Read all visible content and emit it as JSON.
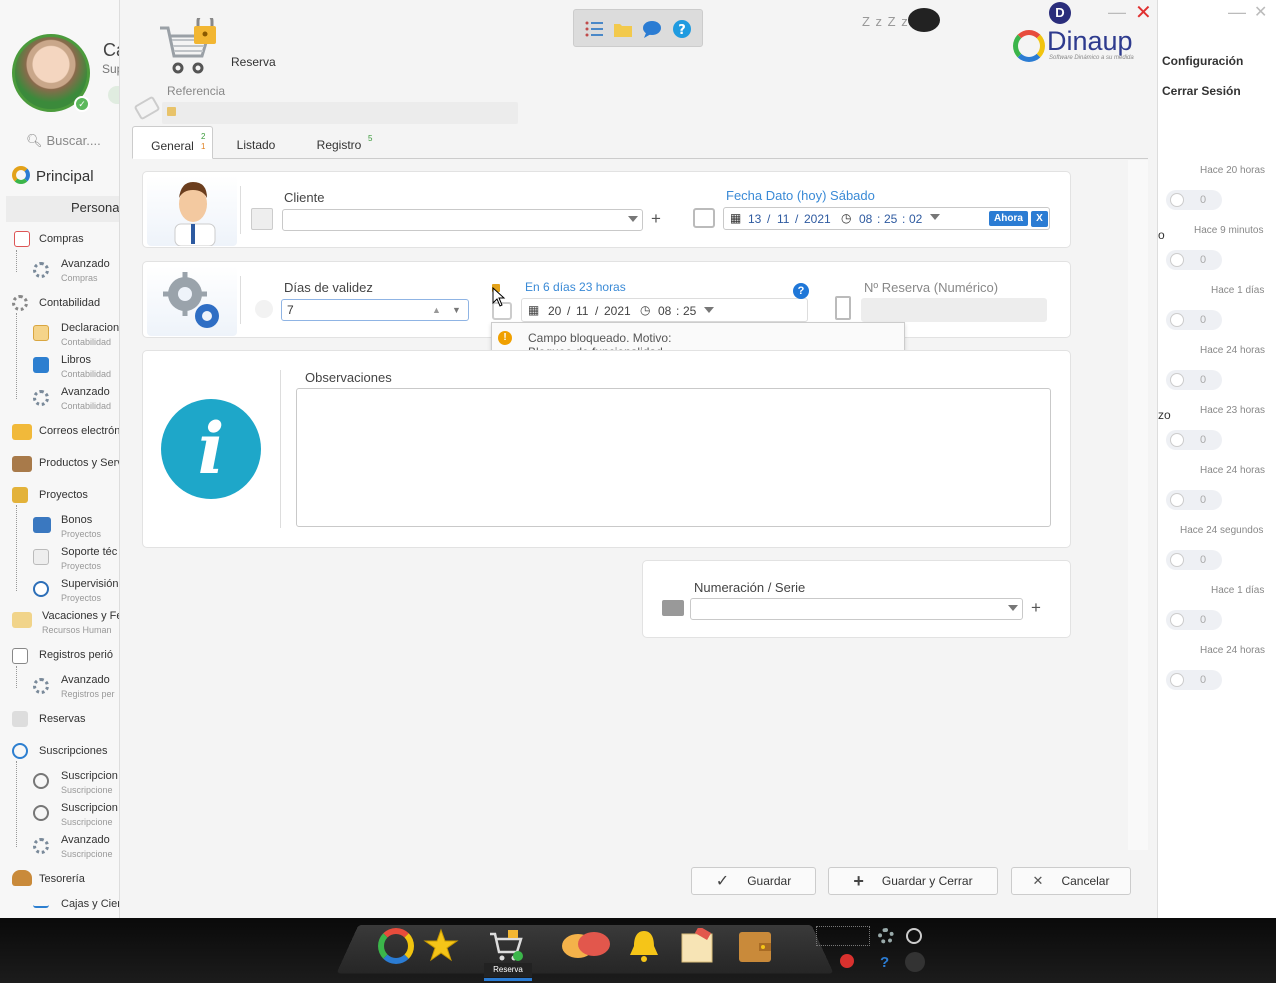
{
  "sidebar": {
    "user_initial_name": "Ca",
    "user_role_short": "Sup",
    "search_placeholder": "Buscar....",
    "principal": "Principal",
    "personal": "Personal",
    "items": [
      {
        "label": "Compras",
        "sub": ""
      },
      {
        "label": "Avanzado",
        "sub": "Compras"
      },
      {
        "label": "Contabilidad",
        "sub": ""
      },
      {
        "label": "Declaracion",
        "sub": "Contabilidad"
      },
      {
        "label": "Libros",
        "sub": "Contabilidad"
      },
      {
        "label": "Avanzado",
        "sub": "Contabilidad"
      },
      {
        "label": "Correos electrón",
        "sub": ""
      },
      {
        "label": "Productos y Serv",
        "sub": ""
      },
      {
        "label": "Proyectos",
        "sub": ""
      },
      {
        "label": "Bonos",
        "sub": "Proyectos"
      },
      {
        "label": "Soporte téc",
        "sub": "Proyectos"
      },
      {
        "label": "Supervisión",
        "sub": "Proyectos"
      },
      {
        "label": "Vacaciones y Fe",
        "sub": "Recursos Human"
      },
      {
        "label": "Registros perió",
        "sub": ""
      },
      {
        "label": "Avanzado",
        "sub": "Registros per"
      },
      {
        "label": "Reservas",
        "sub": ""
      },
      {
        "label": "Suscripciones",
        "sub": ""
      },
      {
        "label": "Suscripcion",
        "sub": "Suscripcione"
      },
      {
        "label": "Suscripcion",
        "sub": "Suscripcione"
      },
      {
        "label": "Avanzado",
        "sub": "Suscripcione"
      },
      {
        "label": "Tesorería",
        "sub": ""
      },
      {
        "label": "Cajas y Cier",
        "sub": ""
      }
    ]
  },
  "header": {
    "title": "Reserva",
    "ref_label": "Referencia",
    "zzz": "Z z Z z",
    "user_badge": "D",
    "logo_text": "Dinaup",
    "logo_sub": "Software Dinámico a su medida"
  },
  "tabs": [
    {
      "label": "General",
      "badge_top": "2",
      "badge_bottom": "1"
    },
    {
      "label": "Listado",
      "badge_top": ""
    },
    {
      "label": "Registro",
      "badge_top": "5"
    }
  ],
  "form": {
    "cliente_label": "Cliente",
    "fecha_label": "Fecha Dato (hoy) Sábado",
    "fecha": {
      "day": "13",
      "month": "11",
      "year": "2021",
      "hh": "08",
      "mm": "25",
      "ss": "02"
    },
    "ahora_label": "Ahora",
    "clear_label": "X",
    "dias_label": "Días de validez",
    "dias_value": "7",
    "vence_label": "En 6 días 23 horas",
    "vence": {
      "day": "20",
      "month": "11",
      "year": "2021",
      "hh": "08",
      "mm": "25"
    },
    "nreserva_label": "Nº Reserva (Numérico)",
    "tooltip_line1": "Campo bloqueado. Motivo:",
    "tooltip_line2": "Bloqueo de funcionalidad.",
    "observaciones_label": "Observaciones",
    "numeracion_label": "Numeración / Serie",
    "help_symbol": "?"
  },
  "footer": {
    "guardar": "Guardar",
    "guardar_cerrar": "Guardar y Cerrar",
    "cancelar": "Cancelar"
  },
  "right_panel": {
    "config": "Configuración",
    "logout": "Cerrar Sesión",
    "notifications": [
      {
        "time": "Hace 20 horas",
        "count": "0",
        "side": ""
      },
      {
        "time": "Hace 9 minutos",
        "count": "0",
        "side": "o"
      },
      {
        "time": "Hace 1 días",
        "count": "0",
        "side": ""
      },
      {
        "time": "Hace 24 horas",
        "count": "0",
        "side": ""
      },
      {
        "time": "Hace 23 horas",
        "count": "0",
        "side": "zo"
      },
      {
        "time": "Hace 24 horas",
        "count": "0",
        "side": ""
      },
      {
        "time": "Hace 24 segundos",
        "count": "0",
        "side": ""
      },
      {
        "time": "Hace 1 días",
        "count": "0",
        "side": ""
      },
      {
        "time": "Hace 24 horas",
        "count": "0",
        "side": ""
      }
    ]
  },
  "taskbar": {
    "active_label": "Reserva"
  },
  "colors": {
    "accent": "#2b7cd3",
    "link_blue": "#3a8ad6",
    "close_red": "#e03030",
    "info_teal": "#1ea7c9"
  }
}
